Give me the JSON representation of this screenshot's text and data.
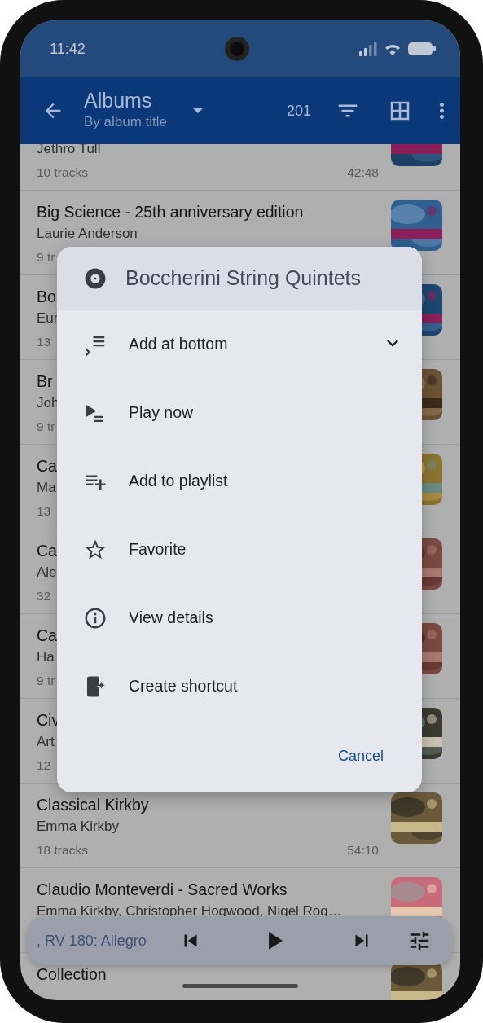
{
  "status_bar": {
    "time": "11:42"
  },
  "app_bar": {
    "title": "Albums",
    "subtitle": "By album title",
    "count": "201"
  },
  "albums": [
    {
      "artist": "Jethro Tull",
      "tracks": "10 tracks",
      "duration": "42:48"
    },
    {
      "title": "Big Science - 25th anniversary edition",
      "artist": "Laurie Anderson",
      "tracks": "9 tr"
    },
    {
      "title": "Bo",
      "artist": "Eur",
      "tracks": "13"
    },
    {
      "title": "Br",
      "artist": "Joh",
      "tracks": "9 tr"
    },
    {
      "title": "Ca",
      "artist": "Ma",
      "tracks": "13"
    },
    {
      "title": "Ca",
      "artist": "Ale",
      "tracks": "32"
    },
    {
      "title": "Ca",
      "artist": "Ha",
      "tracks": "9 tr"
    },
    {
      "title": "Civ",
      "artist": "Art",
      "tracks": "12"
    },
    {
      "title": "Classical Kirkby",
      "artist": "Emma Kirkby",
      "tracks": "18 tracks",
      "duration": "54:10"
    },
    {
      "title": "Claudio Monteverdi - Sacred Works",
      "artist": "Emma Kirkby, Christopher Hogwood, Nigel Rog…"
    },
    {
      "title": "Collection"
    }
  ],
  "dialog": {
    "title": "Boccherini String Quintets",
    "items": [
      {
        "label": "Add at bottom",
        "kind": "split"
      },
      {
        "label": "Play now",
        "kind": "plain"
      },
      {
        "label": "Add to playlist",
        "kind": "plain"
      },
      {
        "label": "Favorite",
        "kind": "plain"
      },
      {
        "label": "View details",
        "kind": "plain"
      },
      {
        "label": "Create shortcut",
        "kind": "plain"
      }
    ],
    "cancel": "Cancel"
  },
  "player": {
    "now_playing": ", RV 180: Allegro"
  }
}
